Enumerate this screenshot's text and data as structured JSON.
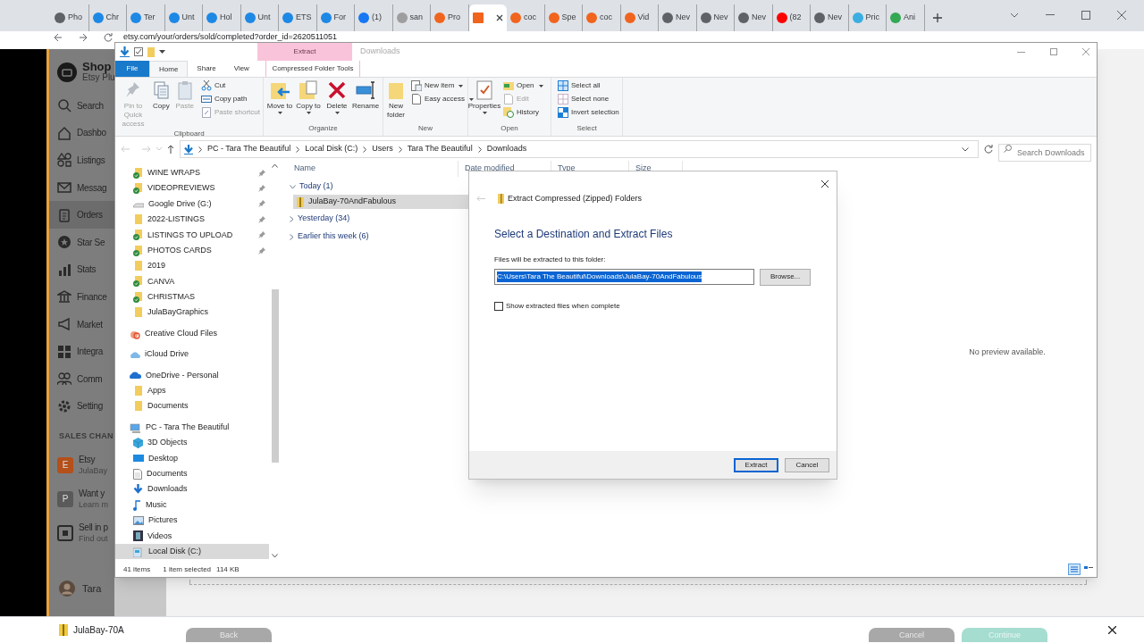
{
  "browser": {
    "tabs": [
      {
        "label": "Pho",
        "color": "#5f6368",
        "selected": false
      },
      {
        "label": "Chr",
        "color": "#1e88e5",
        "selected": false
      },
      {
        "label": "Ter",
        "color": "#1e88e5",
        "selected": false
      },
      {
        "label": "Unt",
        "color": "#1e88e5",
        "selected": false
      },
      {
        "label": "Hol",
        "color": "#1e88e5",
        "selected": false
      },
      {
        "label": "Unt",
        "color": "#1e88e5",
        "selected": false
      },
      {
        "label": "ETS",
        "color": "#1e88e5",
        "selected": false
      },
      {
        "label": "For",
        "color": "#1e88e5",
        "selected": false
      },
      {
        "label": "(1)",
        "color": "#1877f2",
        "selected": false
      },
      {
        "label": "san",
        "color": "#9e9e9e",
        "selected": false
      },
      {
        "label": "Pro",
        "color": "#f1641e",
        "selected": false
      },
      {
        "color": "#f1641e",
        "selected": true
      },
      {
        "label": "coc",
        "color": "#f1641e",
        "selected": false
      },
      {
        "label": "Spe",
        "color": "#f1641e",
        "selected": false
      },
      {
        "label": "coc",
        "color": "#f1641e",
        "selected": false
      },
      {
        "label": "Vid",
        "color": "#f1641e",
        "selected": false
      },
      {
        "label": "Nev",
        "color": "#5f6368",
        "selected": false
      },
      {
        "label": "Nev",
        "color": "#5f6368",
        "selected": false
      },
      {
        "label": "Nev",
        "color": "#5f6368",
        "selected": false
      },
      {
        "label": "(82",
        "color": "#ff0000",
        "selected": false
      },
      {
        "label": "Nev",
        "color": "#5f6368",
        "selected": false
      },
      {
        "label": "Pric",
        "color": "#3aaee0",
        "selected": false
      },
      {
        "label": "Ani",
        "color": "#34a853",
        "selected": false
      }
    ],
    "address": "etsy.com/your/orders/sold/completed?order_id=2620511051"
  },
  "etsy_sidebar": {
    "shop_name": "Shop",
    "shop_plan": "Etsy Plu",
    "items": [
      {
        "label": "Search",
        "selected": false
      },
      {
        "label": "Dashbo",
        "selected": false
      },
      {
        "label": "Listings",
        "selected": false
      },
      {
        "label": "Messag",
        "selected": false
      },
      {
        "label": "Orders",
        "selected": true
      },
      {
        "label": "Star Se",
        "selected": false
      },
      {
        "label": "Stats",
        "selected": false
      },
      {
        "label": "Finance",
        "selected": false
      },
      {
        "label": "Market",
        "selected": false
      },
      {
        "label": "Integra",
        "selected": false
      },
      {
        "label": "Comm",
        "selected": false
      },
      {
        "label": "Setting",
        "selected": false
      }
    ],
    "section": "SALES CHAN",
    "channels": [
      {
        "badge": "E",
        "title": "Etsy",
        "subtitle": "JulaBay",
        "color": "#b4501a"
      },
      {
        "badge": "P",
        "title": "Want y",
        "subtitle": "Learn m",
        "color": "#5a5a5a"
      },
      {
        "title": "Sell in p",
        "subtitle": "Find out"
      }
    ],
    "user": "Tara"
  },
  "etsy_footer": {
    "buttons": [
      {
        "label": "Back",
        "kind": "secondary"
      },
      {
        "label": "Cancel",
        "kind": "secondary"
      },
      {
        "label": "Continue",
        "kind": "primary"
      }
    ]
  },
  "download_bar": {
    "file": "JulaBay-70A"
  },
  "explorer": {
    "context_tab": "Extract",
    "title": "Downloads",
    "ribbon_tabs": [
      {
        "label": "File",
        "kind": "file",
        "selected": false
      },
      {
        "label": "Home",
        "kind": "tab",
        "selected": true
      },
      {
        "label": "Share",
        "kind": "tab",
        "selected": false
      },
      {
        "label": "View",
        "kind": "tab",
        "selected": false
      },
      {
        "label": "Compressed Folder Tools",
        "kind": "context",
        "selected": false
      }
    ],
    "ribbon_groups": [
      {
        "name": "Clipboard",
        "commands": [
          {
            "label": "Pin to Quick access",
            "kind": "large",
            "disabled": true
          },
          {
            "label": "Copy",
            "kind": "large",
            "disabled": false
          },
          {
            "label": "Paste",
            "kind": "large",
            "disabled": true
          },
          {
            "label": "Cut",
            "kind": "small",
            "disabled": false
          },
          {
            "label": "Copy path",
            "kind": "small",
            "disabled": false
          },
          {
            "label": "Paste shortcut",
            "kind": "small",
            "disabled": true
          }
        ]
      },
      {
        "name": "Organize",
        "commands": [
          {
            "label": "Move to",
            "kind": "large",
            "disabled": false,
            "dropdown": true
          },
          {
            "label": "Copy to",
            "kind": "large",
            "disabled": false,
            "dropdown": true
          },
          {
            "label": "Delete",
            "kind": "large",
            "disabled": false,
            "dropdown": true
          },
          {
            "label": "Rename",
            "kind": "large",
            "disabled": false
          }
        ]
      },
      {
        "name": "New",
        "commands": [
          {
            "label": "New folder",
            "kind": "large",
            "disabled": false
          },
          {
            "label": "New item",
            "kind": "small",
            "disabled": false,
            "dropdown": true
          },
          {
            "label": "Easy access",
            "kind": "small",
            "disabled": false,
            "dropdown": true
          }
        ]
      },
      {
        "name": "Open",
        "commands": [
          {
            "label": "Properties",
            "kind": "large",
            "disabled": false,
            "dropdown": true
          },
          {
            "label": "Open",
            "kind": "small",
            "disabled": false,
            "dropdown": true
          },
          {
            "label": "Edit",
            "kind": "small",
            "disabled": true
          },
          {
            "label": "History",
            "kind": "small",
            "disabled": false
          }
        ]
      },
      {
        "name": "Select",
        "commands": [
          {
            "label": "Select all",
            "kind": "small",
            "disabled": false
          },
          {
            "label": "Select none",
            "kind": "small",
            "disabled": false
          },
          {
            "label": "Invert selection",
            "kind": "small",
            "disabled": false
          }
        ]
      }
    ],
    "breadcrumbs": [
      "PC - Tara The Beautiful",
      "Local Disk (C:)",
      "Users",
      "Tara The Beautiful",
      "Downloads"
    ],
    "search": {
      "placeholder": "Search Downloads"
    },
    "quick_access": [
      {
        "label": "WINE WRAPS",
        "kind": "synced",
        "pinned": true
      },
      {
        "label": "VIDEOPREVIEWS",
        "kind": "synced",
        "pinned": true
      },
      {
        "label": "Google Drive (G:)",
        "kind": "drive",
        "pinned": true
      },
      {
        "label": "2022-LISTINGS",
        "kind": "folder",
        "pinned": true
      },
      {
        "label": "LISTINGS TO UPLOAD",
        "kind": "synced",
        "pinned": true
      },
      {
        "label": "PHOTOS CARDS",
        "kind": "synced",
        "pinned": true
      },
      {
        "label": "2019",
        "kind": "folder",
        "pinned": false
      },
      {
        "label": "CANVA",
        "kind": "synced",
        "pinned": false
      },
      {
        "label": "CHRISTMAS",
        "kind": "synced",
        "pinned": false
      },
      {
        "label": "JulaBayGraphics",
        "kind": "folder",
        "pinned": false
      }
    ],
    "nav_tree": [
      {
        "label": "Creative Cloud Files",
        "kind": "creative",
        "selected": false
      },
      {
        "label": "iCloud Drive",
        "kind": "cloud",
        "selected": false
      },
      {
        "label": "OneDrive - Personal",
        "kind": "onedrive",
        "selected": false,
        "children": [
          {
            "label": "Apps",
            "kind": "folder",
            "selected": false
          },
          {
            "label": "Documents",
            "kind": "folder",
            "selected": false
          }
        ]
      },
      {
        "label": "PC - Tara The Beautiful",
        "kind": "pc",
        "selected": false,
        "children": [
          {
            "label": "3D Objects",
            "kind": "objects",
            "selected": false
          },
          {
            "label": "Desktop",
            "kind": "desktop",
            "selected": false
          },
          {
            "label": "Documents",
            "kind": "documents",
            "selected": false
          },
          {
            "label": "Downloads",
            "kind": "downloads",
            "selected": false
          },
          {
            "label": "Music",
            "kind": "music",
            "selected": false
          },
          {
            "label": "Pictures",
            "kind": "pictures",
            "selected": false
          },
          {
            "label": "Videos",
            "kind": "videos",
            "selected": false
          },
          {
            "label": "Local Disk (C:)",
            "kind": "disk",
            "selected": true
          }
        ]
      }
    ],
    "columns": [
      "Name",
      "Date modified",
      "Type",
      "Size"
    ],
    "groups": [
      {
        "label": "Today (1)",
        "expanded": true,
        "files": [
          {
            "name": "JulaBay-70AndFabulous",
            "selected": true
          }
        ]
      },
      {
        "label": "Yesterday (34)",
        "expanded": false
      },
      {
        "label": "Earlier this week (6)",
        "expanded": false
      }
    ],
    "preview": "No preview available.",
    "status": {
      "count": "41 items",
      "selection": "1 item selected",
      "size": "114 KB"
    }
  },
  "dialog": {
    "title": "Extract Compressed (Zipped) Folders",
    "heading": "Select a Destination and Extract Files",
    "label": "Files will be extracted to this folder:",
    "path": "C:\\Users\\Tara The Beautiful\\Downloads\\JulaBay-70AndFabulous",
    "browse": "Browse...",
    "checkbox": {
      "label": "Show extracted files when complete",
      "checked": false
    },
    "buttons": [
      {
        "label": "Extract",
        "default": true
      },
      {
        "label": "Cancel",
        "default": false
      }
    ]
  }
}
